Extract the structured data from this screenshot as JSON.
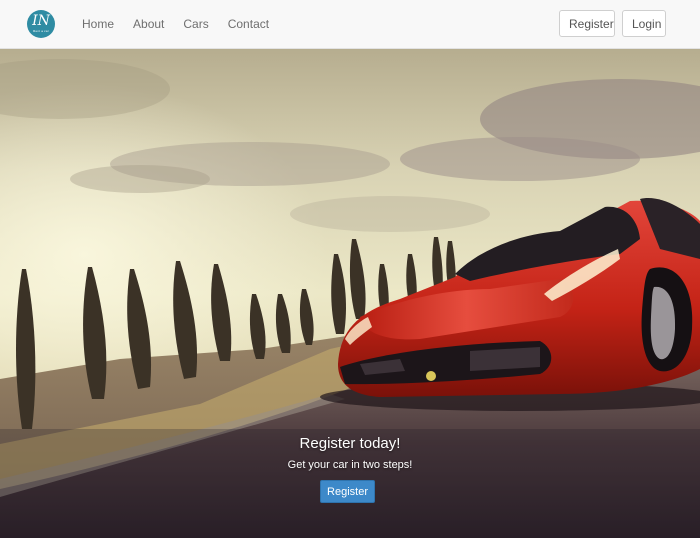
{
  "brand": {
    "logo_text": "IN",
    "logo_subtext": "Rent a car"
  },
  "nav": {
    "links": [
      "Home",
      "About",
      "Cars",
      "Contact"
    ],
    "register_label": "Register",
    "login_label": "Login"
  },
  "hero": {
    "title": "Register today!",
    "subtitle": "Get your car in two steps!",
    "button_label": "Register"
  },
  "colors": {
    "accent": "#3d89c9",
    "logo": "#2f8ca3",
    "navbar": "#f8f8f8",
    "car": "#c42316"
  }
}
